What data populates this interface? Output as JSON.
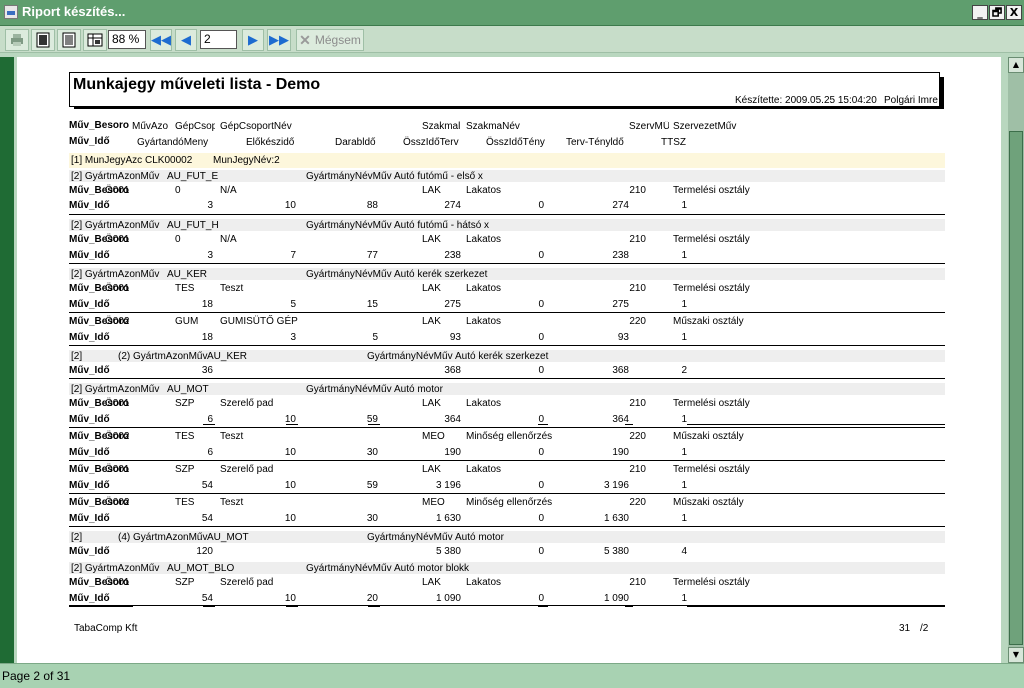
{
  "window": {
    "title": "Riport készítés...",
    "btn_min": "_",
    "btn_restore": "🗗",
    "btn_close": "X"
  },
  "toolbar": {
    "zoom_value": "88 %",
    "page_value": "2",
    "cancel_label": "Mégsem"
  },
  "status": {
    "text": "Page 2 of 31"
  },
  "report": {
    "title": "Munkajegy műveleti lista - Demo",
    "created": "Készítette: 2009.05.25 15:04:20",
    "created_by": "Polgári Imre",
    "footer_company": "TabaComp Kft",
    "footer_page": "31",
    "footer_total": "/2",
    "col_hdr1": {
      "a": "Műv_Besoro",
      "b": "MűvAzo",
      "c": "GépCsop",
      "d": "GépCsoportNév",
      "e": "Szakmal",
      "f": "SzakmaNév",
      "g": "SzervMŰ",
      "h": "SzervezetMűv"
    },
    "col_hdr2": {
      "a": "Műv_Idő",
      "b": "GyártandóMeny",
      "c": "Előkészidő",
      "d": "Darabldő",
      "e": "ÖsszIdőTerv",
      "f": "ÖsszIdőTény",
      "g": "Terv-Tényldő",
      "h": "TTSZ"
    },
    "group1": {
      "a": "[1] MunJegyAzc",
      "b": "CLK00002",
      "c": "MunJegyNév:2"
    },
    "groups": [
      {
        "g": "[2] GyártmAzonMűv",
        "id": "AU_FUT_E",
        "nl": "GyártmányNévMűv",
        "nm": "Autó futómű - első x"
      },
      {
        "g": "[2] GyártmAzonMűv",
        "id": "AU_FUT_H",
        "nl": "GyártmányNévMűv",
        "nm": "Autó futómű - hátsó x"
      },
      {
        "g": "[2] GyártmAzonMűv",
        "id": "AU_KER",
        "nl": "GyártmányNévMűv",
        "nm": "Autó kerék szerkezet"
      },
      {
        "g": "[2]",
        "sub": "(2) GyártmAzonMűv",
        "id": "AU_KER",
        "nl": "GyártmányNévMűv",
        "nm": "Autó kerék szerkezet"
      },
      {
        "g": "[2] GyártmAzonMűv",
        "id": "AU_MOT",
        "nl": "GyártmányNévMűv",
        "nm": "Autó motor"
      },
      {
        "g": "[2]",
        "sub": "(4) GyártmAzonMűv",
        "id": "AU_MOT",
        "nl": "GyártmányNévMűv",
        "nm": "Autó motor"
      },
      {
        "g": "[2] GyártmAzonMűv",
        "id": "AU_MOT_BLO",
        "nl": "GyártmányNévMűv",
        "nm": "Autó motor blokk"
      }
    ],
    "rows": [
      {
        "lbl": "Műv_Besoro",
        "az": "Ö001",
        "gc": "0",
        "gn": "N/A",
        "sz": "LAK",
        "sn": "Lakatos",
        "sv": "210",
        "so": "Termelési osztály"
      },
      {
        "lbl": "Műv_Idő",
        "m": "3",
        "e": "10",
        "d": "88",
        "t": "274",
        "r": "0",
        "k": "274",
        "x": "1"
      },
      {
        "lbl": "Műv_Besoro",
        "az": "Ö001",
        "gc": "0",
        "gn": "N/A",
        "sz": "LAK",
        "sn": "Lakatos",
        "sv": "210",
        "so": "Termelési osztály"
      },
      {
        "lbl": "Műv_Idő",
        "m": "3",
        "e": "7",
        "d": "77",
        "t": "238",
        "r": "0",
        "k": "238",
        "x": "1"
      },
      {
        "lbl": "Műv_Besoro",
        "az": "Ö001",
        "gc": "TES",
        "gn": "Teszt",
        "sz": "LAK",
        "sn": "Lakatos",
        "sv": "210",
        "so": "Termelési osztály"
      },
      {
        "lbl": "Műv_Idő",
        "m": "18",
        "e": "5",
        "d": "15",
        "t": "275",
        "r": "0",
        "k": "275",
        "x": "1"
      },
      {
        "lbl": "Műv_Besoro",
        "az": "Ö002",
        "gc": "GUM",
        "gn": "GUMISÜTŐ GÉP",
        "sz": "LAK",
        "sn": "Lakatos",
        "sv": "220",
        "so": "Műszaki osztály"
      },
      {
        "lbl": "Műv_Idő",
        "m": "18",
        "e": "3",
        "d": "5",
        "t": "93",
        "r": "0",
        "k": "93",
        "x": "1"
      },
      {
        "lbl": "Műv_Idő",
        "m": "36",
        "t": "368",
        "r": "0",
        "k": "368",
        "x": "2"
      },
      {
        "lbl": "Műv_Besoro",
        "az": "Ö001",
        "gc": "SZP",
        "gn": "Szerelő pad",
        "sz": "LAK",
        "sn": "Lakatos",
        "sv": "210",
        "so": "Termelési osztály"
      },
      {
        "lbl": "Műv_Idő",
        "m": "6",
        "e": "10",
        "d": "59",
        "t": "364",
        "r": "0",
        "k": "364",
        "x": "1"
      },
      {
        "lbl": "Műv_Besoro",
        "az": "Ö002",
        "gc": "TES",
        "gn": "Teszt",
        "sz": "MEO",
        "sn": "Minőség ellenőrzés",
        "sv": "220",
        "so": "Műszaki osztály"
      },
      {
        "lbl": "Műv_Idő",
        "m": "6",
        "e": "10",
        "d": "30",
        "t": "190",
        "r": "0",
        "k": "190",
        "x": "1"
      },
      {
        "lbl": "Műv_Besoro",
        "az": "Ö001",
        "gc": "SZP",
        "gn": "Szerelő pad",
        "sz": "LAK",
        "sn": "Lakatos",
        "sv": "210",
        "so": "Termelési osztály"
      },
      {
        "lbl": "Műv_Idő",
        "m": "54",
        "e": "10",
        "d": "59",
        "t": "3 196",
        "r": "0",
        "k": "3 196",
        "x": "1"
      },
      {
        "lbl": "Műv_Besoro",
        "az": "Ö002",
        "gc": "TES",
        "gn": "Teszt",
        "sz": "MEO",
        "sn": "Minőség ellenőrzés",
        "sv": "220",
        "so": "Műszaki osztály"
      },
      {
        "lbl": "Műv_Idő",
        "m": "54",
        "e": "10",
        "d": "30",
        "t": "1 630",
        "r": "0",
        "k": "1 630",
        "x": "1"
      },
      {
        "lbl": "Műv_Idő",
        "m": "120",
        "t": "5 380",
        "r": "0",
        "k": "5 380",
        "x": "4"
      },
      {
        "lbl": "Műv_Besoro",
        "az": "Ö001",
        "gc": "SZP",
        "gn": "Szerelő pad",
        "sz": "LAK",
        "sn": "Lakatos",
        "sv": "210",
        "so": "Termelési osztály"
      },
      {
        "lbl": "Műv_Idő",
        "m": "54",
        "e": "10",
        "d": "20",
        "t": "1 090",
        "r": "0",
        "k": "1 090",
        "x": "1"
      }
    ]
  }
}
